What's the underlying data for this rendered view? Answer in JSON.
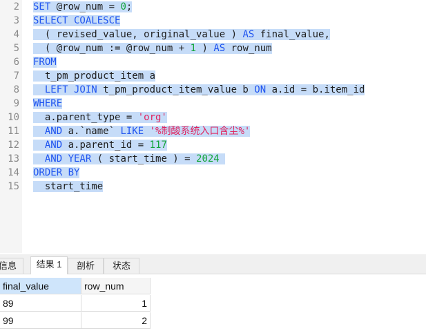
{
  "editor": {
    "line_numbers": [
      "2",
      "3",
      "4",
      "5",
      "6",
      "7",
      "8",
      "9",
      "10",
      "11",
      "12",
      "13",
      "14",
      "15"
    ],
    "lines": [
      [
        {
          "t": "SET @row_num = ",
          "c": "kwtxt"
        },
        {
          "t": "0",
          "c": "num"
        },
        {
          "t": ";",
          "c": "txt"
        }
      ],
      [
        {
          "t": "SELECT COALESCE",
          "c": "kw"
        }
      ],
      [
        {
          "t": "  ( revised_value, original_value ) ",
          "c": "txt"
        },
        {
          "t": "AS",
          "c": "kw"
        },
        {
          "t": " final_value,",
          "c": "txt"
        }
      ],
      [
        {
          "t": "  ( @row_num := @row_num + ",
          "c": "txt"
        },
        {
          "t": "1",
          "c": "num"
        },
        {
          "t": " ) ",
          "c": "txt"
        },
        {
          "t": "AS",
          "c": "kw"
        },
        {
          "t": " row_num",
          "c": "txt"
        }
      ],
      [
        {
          "t": "FROM",
          "c": "kw"
        }
      ],
      [
        {
          "t": "  t_pm_product_item a",
          "c": "txt"
        }
      ],
      [
        {
          "t": "  ",
          "c": "txt"
        },
        {
          "t": "LEFT JOIN",
          "c": "kw"
        },
        {
          "t": " t_pm_product_item_value b ",
          "c": "txt"
        },
        {
          "t": "ON",
          "c": "kw"
        },
        {
          "t": " a.id = b.item_id",
          "c": "txt"
        }
      ],
      [
        {
          "t": "WHERE",
          "c": "kw"
        }
      ],
      [
        {
          "t": "  a.parent_type = ",
          "c": "txt"
        },
        {
          "t": "'org'",
          "c": "str"
        }
      ],
      [
        {
          "t": "  ",
          "c": "txt"
        },
        {
          "t": "AND",
          "c": "kw"
        },
        {
          "t": " a.`name` ",
          "c": "txt"
        },
        {
          "t": "LIKE",
          "c": "kw"
        },
        {
          "t": " ",
          "c": "txt"
        },
        {
          "t": "'%制酸系统入口含尘%'",
          "c": "str"
        }
      ],
      [
        {
          "t": "  ",
          "c": "txt"
        },
        {
          "t": "AND",
          "c": "kw"
        },
        {
          "t": " a.parent_id = ",
          "c": "txt"
        },
        {
          "t": "117",
          "c": "num"
        }
      ],
      [
        {
          "t": "  ",
          "c": "txt"
        },
        {
          "t": "AND YEAR",
          "c": "kw"
        },
        {
          "t": " ( start_time ) = ",
          "c": "txt"
        },
        {
          "t": "2024",
          "c": "num"
        },
        {
          "t": " ",
          "c": "txt"
        }
      ],
      [
        {
          "t": "ORDER BY",
          "c": "kw"
        }
      ],
      [
        {
          "t": "  start_time",
          "c": "txt"
        }
      ]
    ]
  },
  "tabs": [
    {
      "label": "信息",
      "active": false
    },
    {
      "label": "结果 1",
      "active": true
    },
    {
      "label": "剖析",
      "active": false
    },
    {
      "label": "状态",
      "active": false
    }
  ],
  "grid": {
    "columns": [
      "final_value",
      "row_num"
    ],
    "rows": [
      [
        "89",
        "1"
      ],
      [
        "99",
        "2"
      ]
    ]
  },
  "colors": {
    "keyword": "#1f54f0",
    "number": "#13a53a",
    "string": "#e0245e",
    "selection": "#c6dcf8"
  }
}
